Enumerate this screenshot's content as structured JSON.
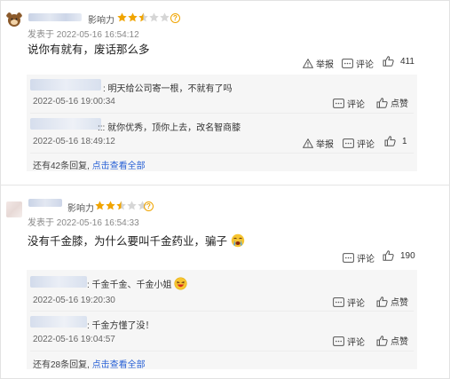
{
  "comments": [
    {
      "influence_label": "影响力",
      "rating": 2.5,
      "time": "发表于 2022-05-16 16:54:12",
      "content": "说你有就有，废话那么多",
      "actions": {
        "report": "举报",
        "comment": "评论",
        "like_count": "411"
      },
      "replies": [
        {
          "text": ": 明天给公司寄一根，不就有了吗",
          "time": "2022-05-16 19:00:34",
          "actions": {
            "comment": "评论",
            "like": "点赞"
          }
        },
        {
          "text": "::: 就你优秀，顶你上去，改名智商膝",
          "time": "2022-05-16 18:49:12",
          "actions": {
            "report": "举报",
            "comment": "评论",
            "like_count": "1"
          }
        }
      ],
      "more": {
        "prefix": "还有42条回复,",
        "link": "点击查看全部"
      }
    },
    {
      "influence_label": "影响力",
      "rating": 2.5,
      "time": "发表于 2022-05-16 16:54:33",
      "content": "没有千金膝，为什么要叫千金药业，骗子",
      "actions": {
        "comment": "评论",
        "like_count": "190"
      },
      "replies": [
        {
          "text": ": 千金千金、千金小姐",
          "time": "2022-05-16 19:20:30",
          "actions": {
            "comment": "评论",
            "like": "点赞"
          }
        },
        {
          "text": ": 千金方懂了没！",
          "time": "2022-05-16 19:04:57",
          "actions": {
            "comment": "评论",
            "like": "点赞"
          }
        }
      ],
      "more": {
        "prefix": "还有28条回复,",
        "link": "点击查看全部"
      }
    }
  ],
  "icons": {
    "star": "star-icon",
    "report": "warning-triangle-icon",
    "comment": "comment-bubble-icon",
    "like": "thumbs-up-icon"
  },
  "colors": {
    "star_filled": "#f0a400",
    "star_empty": "#d6d6d6",
    "link": "#2b63d6"
  }
}
